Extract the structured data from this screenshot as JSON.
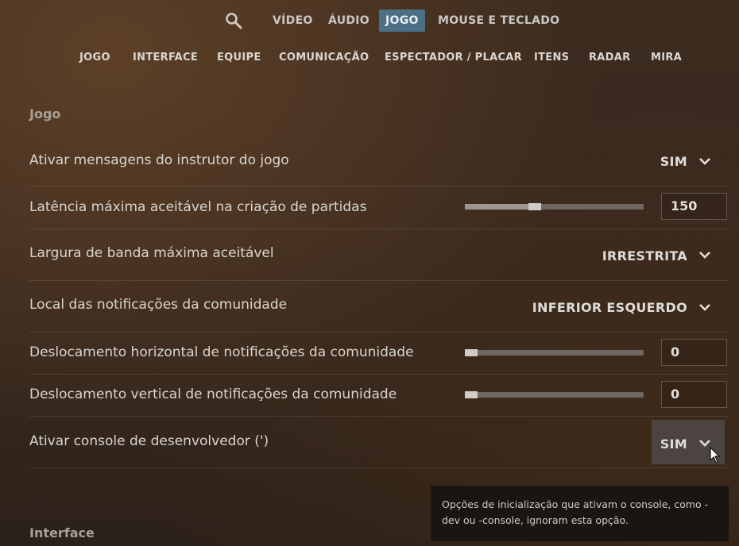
{
  "top_nav": {
    "search_icon": "search-icon",
    "tabs": [
      {
        "label": "VÍDEO",
        "active": false
      },
      {
        "label": "ÁUDIO",
        "active": false
      },
      {
        "label": "JOGO",
        "active": true
      },
      {
        "label": "MOUSE E TECLADO",
        "active": false
      }
    ],
    "active_color": "#4b6f85"
  },
  "sub_nav": {
    "tabs": [
      "JOGO",
      "INTERFACE",
      "EQUIPE",
      "COMUNICAÇÃO",
      "ESPECTADOR / PLACAR",
      "ITENS",
      "RADAR",
      "MIRA"
    ]
  },
  "sections": {
    "jogo_title": "Jogo",
    "interface_title": "Interface"
  },
  "settings": [
    {
      "label": "Ativar mensagens do instrutor do jogo",
      "control": "dropdown",
      "value": "SIM"
    },
    {
      "label": "Latência máxima aceitável na criação de partidas",
      "control": "slider",
      "value": "150",
      "fill_percent": 40
    },
    {
      "label": "Largura de banda máxima aceitável",
      "control": "dropdown",
      "value": "IRRESTRITA"
    },
    {
      "label": "Local das notificações da comunidade",
      "control": "dropdown",
      "value": "INFERIOR ESQUERDO"
    },
    {
      "label": "Deslocamento horizontal de notificações da comunidade",
      "control": "slider",
      "value": "0",
      "fill_percent": 0
    },
    {
      "label": "Deslocamento vertical de notificações da comunidade",
      "control": "slider",
      "value": "0",
      "fill_percent": 0
    },
    {
      "label": "Ativar console de desenvolvedor (')",
      "control": "dropdown",
      "value": "SIM",
      "hovered": true
    }
  ],
  "tooltip": {
    "text": "Opções de inicialização que ativam o console, como -dev ou -console, ignoram esta opção."
  }
}
